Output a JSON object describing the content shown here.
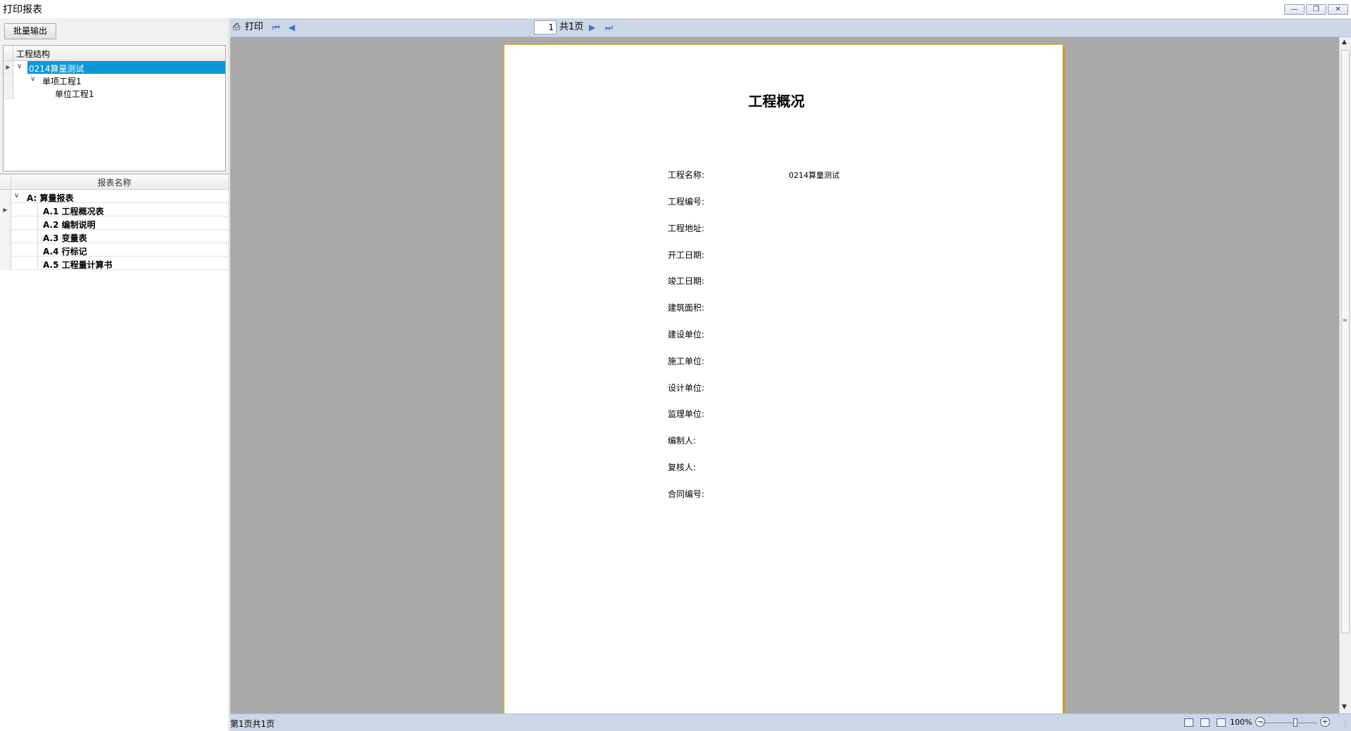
{
  "window": {
    "title": "打印报表",
    "minimize_icon": "minimize-icon",
    "restore_icon": "restore-icon",
    "close_icon": "close-icon"
  },
  "left_panel": {
    "batch_export_label": "批量输出",
    "project_tree": {
      "header": "工程结构",
      "items": [
        {
          "label": "0214算量测试",
          "level": 0,
          "expanded": true,
          "selected": true
        },
        {
          "label": "单项工程1",
          "level": 1,
          "expanded": true,
          "selected": false
        },
        {
          "label": "单位工程1",
          "level": 2,
          "expanded": false,
          "selected": false
        }
      ]
    },
    "report_grid": {
      "header": "报表名称",
      "group": {
        "label": "A:  算量报表",
        "expanded": true
      },
      "items": [
        {
          "label": "A.1 工程概况表",
          "current": true
        },
        {
          "label": "A.2 编制说明",
          "current": false
        },
        {
          "label": "A.3 变量表",
          "current": false
        },
        {
          "label": "A.4 行标记",
          "current": false
        },
        {
          "label": "A.5 工程量计算书",
          "current": false
        }
      ]
    }
  },
  "toolbar": {
    "print_label": "打印",
    "print_icon": "printer-icon",
    "first_icon": "first-page-icon",
    "prev_icon": "prev-page-icon",
    "page_value": "1",
    "page_total": "共1页",
    "next_icon": "next-page-icon",
    "last_icon": "last-page-icon"
  },
  "report_page": {
    "title": "工程概况",
    "fields": [
      {
        "label": "工程名称:",
        "value": "0214算量测试"
      },
      {
        "label": "工程编号:",
        "value": ""
      },
      {
        "label": "工程地址:",
        "value": ""
      },
      {
        "label": "开工日期:",
        "value": ""
      },
      {
        "label": "竣工日期:",
        "value": ""
      },
      {
        "label": "建筑面积:",
        "value": ""
      },
      {
        "label": "建设单位:",
        "value": ""
      },
      {
        "label": "施工单位:",
        "value": ""
      },
      {
        "label": "设计单位:",
        "value": ""
      },
      {
        "label": "监理单位:",
        "value": ""
      },
      {
        "label": "编制人:",
        "value": ""
      },
      {
        "label": "复核人:",
        "value": ""
      },
      {
        "label": "合同编号:",
        "value": ""
      }
    ]
  },
  "statusbar": {
    "page_info": "第1页共1页",
    "zoom": "100%",
    "zoom_fraction": 0.62,
    "colors": {
      "bar": "#cbd6e6",
      "selection": "#0d97d6",
      "page_border": "#e0b040"
    }
  }
}
